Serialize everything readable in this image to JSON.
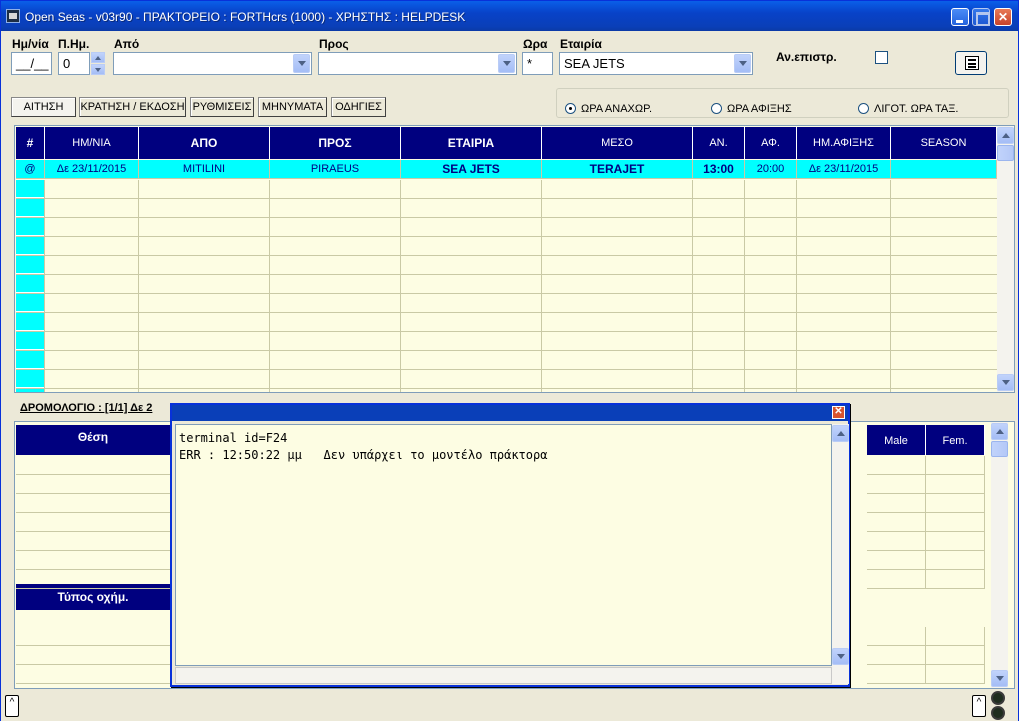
{
  "window": {
    "title": "Open Seas  - v03r90 - ΠΡΑΚΤΟΡΕΙΟ : FORTHcrs (1000) - ΧΡΗΣΤΗΣ : HELPDESK"
  },
  "search": {
    "date_label": "Ημ/νία",
    "date_value": "__/__",
    "plusdays_label": "Π.Ημ.",
    "plusdays_value": "0",
    "from_label": "Από",
    "from_value": "",
    "to_label": "Προς",
    "to_value": "",
    "time_label": "Ωρα",
    "time_value": "*",
    "company_label": "Εταιρία",
    "company_value": "SEA JETS",
    "return_label": "Αν.επιστρ.",
    "return_checked": false
  },
  "tabs": [
    {
      "label": "ΑΙΤΗΣΗ",
      "active": true
    },
    {
      "label": "ΚΡΑΤΗΣΗ / ΕΚΔΟΣΗ",
      "active": false
    },
    {
      "label": "ΡΥΘΜΙΣΕΙΣ",
      "active": false
    },
    {
      "label": "ΜΗΝΥΜΑΤΑ",
      "active": false
    },
    {
      "label": "ΟΔΗΓΙΕΣ",
      "active": false
    }
  ],
  "sort_options": [
    {
      "label": "ΩΡΑ ΑΝΑΧΩΡ.",
      "selected": true
    },
    {
      "label": "ΩΡΑ ΑΦΙΞΗΣ",
      "selected": false
    },
    {
      "label": "ΛΙΓΟΤ. ΩΡΑ ΤΑΞ.",
      "selected": false
    }
  ],
  "results": {
    "columns": [
      "#",
      "ΗΜ/ΝΙΑ",
      "ΑΠΟ",
      "ΠΡΟΣ",
      "ΕΤΑΙΡΙΑ",
      "ΜΕΣΟ",
      "ΑΝ.",
      "ΑΦ.",
      "ΗΜ.ΑΦΙΞΗΣ",
      "SEASON"
    ],
    "rows": [
      {
        "mark": "@",
        "date": "Δε 23/11/2015",
        "from": "MITILINI",
        "to": "PIRAEUS",
        "company": "SEA JETS",
        "vessel": "TERAJET",
        "dep": "13:00",
        "arr": "20:00",
        "arr_date": "Δε 23/11/2015",
        "season": ""
      }
    ]
  },
  "itinerary": {
    "label": "ΔΡΟΜΟΛΟΓΙΟ : [1/1]  Δε 2"
  },
  "lower": {
    "seat_header": "Θέση",
    "vehicle_header": "Τύπος οχήμ.",
    "male_header": "Male",
    "female_header": "Fem."
  },
  "dialog": {
    "line1": "terminal id=F24",
    "line2": "ERR : 12:50:22 μμ   Δεν υπάρχει το μοντέλο πράκτορα"
  },
  "colors": {
    "header_bg": "#00007f",
    "selected_row": "#00ffff",
    "grid_bg": "#fdfde3"
  }
}
